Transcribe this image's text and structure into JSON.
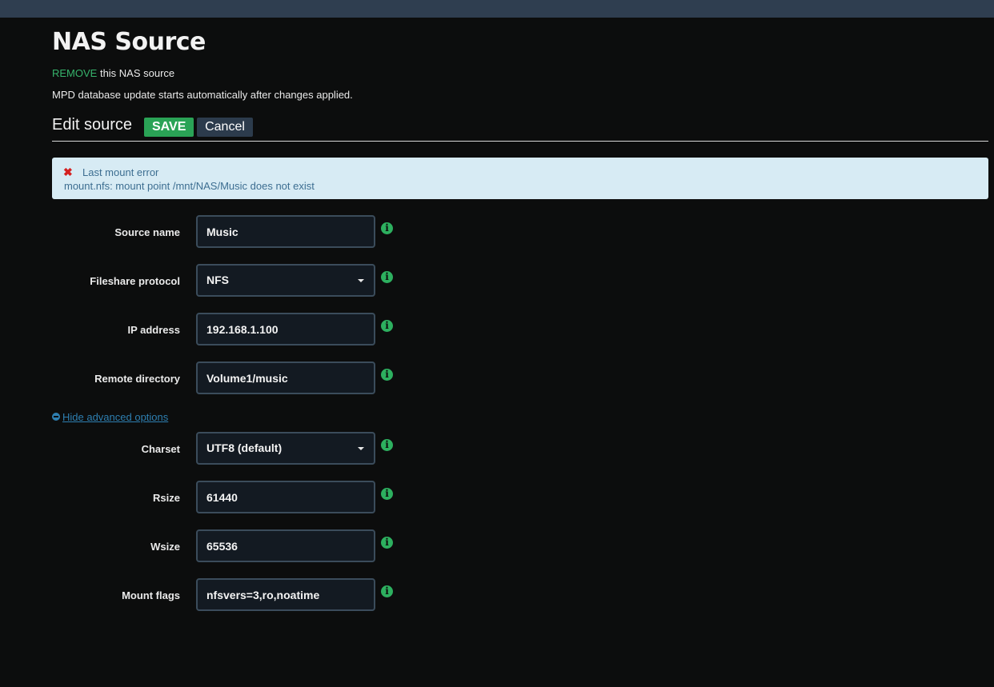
{
  "page": {
    "title": "NAS Source",
    "remove_link": "REMOVE",
    "remove_suffix": " this NAS source",
    "info_text": "MPD database update starts automatically after changes applied."
  },
  "edit": {
    "heading": "Edit source",
    "save_label": "SAVE",
    "cancel_label": "Cancel"
  },
  "alert": {
    "icon": "close-icon",
    "title": "Last mount error",
    "message": "mount.nfs: mount point /mnt/NAS/Music does not exist"
  },
  "fields": {
    "source_name": {
      "label": "Source name",
      "value": "Music"
    },
    "protocol": {
      "label": "Fileshare protocol",
      "value": "NFS"
    },
    "ip_address": {
      "label": "IP address",
      "value": "192.168.1.100"
    },
    "remote_dir": {
      "label": "Remote directory",
      "value": "Volume1/music"
    },
    "charset": {
      "label": "Charset",
      "value": "UTF8 (default)"
    },
    "rsize": {
      "label": "Rsize",
      "value": "61440"
    },
    "wsize": {
      "label": "Wsize",
      "value": "65536"
    },
    "mount_flags": {
      "label": "Mount flags",
      "value": "nfsvers=3,ro,noatime"
    }
  },
  "advanced": {
    "toggle_label": "Hide advanced options"
  },
  "colors": {
    "topbar": "#2f3e50",
    "save": "#2aa356",
    "cancel": "#2c3b4c",
    "remove": "#36b36b",
    "alert_bg": "#d7ebf4",
    "info_icon": "#2db05f",
    "link": "#2e7fb1"
  }
}
